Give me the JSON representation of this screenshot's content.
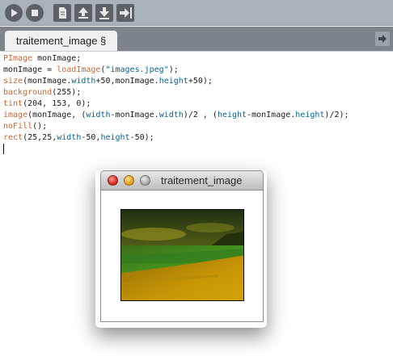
{
  "toolbar": {
    "buttons": [
      {
        "name": "run-button",
        "icon": "play-icon"
      },
      {
        "name": "stop-button",
        "icon": "stop-icon"
      },
      {
        "name": "new-button",
        "icon": "document-icon"
      },
      {
        "name": "open-button",
        "icon": "arrow-up-icon"
      },
      {
        "name": "save-button",
        "icon": "arrow-down-icon"
      },
      {
        "name": "export-button",
        "icon": "export-icon"
      }
    ]
  },
  "tabs": {
    "active_label": "traitement_image §",
    "menu_icon": "arrow-right-icon"
  },
  "editor": {
    "lines": [
      "PImage monImage;",
      "monImage = loadImage(\"images.jpeg\");",
      "size(monImage.width+50,monImage.height+50);",
      "background(255);",
      "tint(204, 153, 0);",
      "image(monImage, (width-monImage.width)/2 , (height-monImage.height)/2);",
      "noFill();",
      "rect(25,25,width-50,height-50);"
    ]
  },
  "sketch_window": {
    "title": "traitement_image",
    "image_description": "tinted beach photo",
    "tint_color": "#cc9900"
  }
}
